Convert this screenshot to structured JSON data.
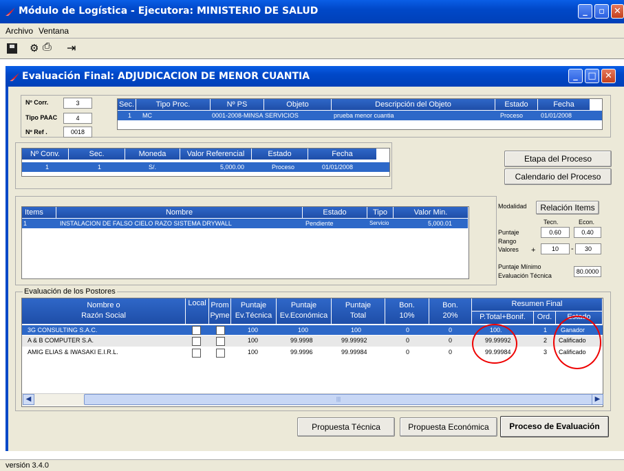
{
  "main_window": {
    "title": "Módulo de Logística - Ejecutora: MINISTERIO DE SALUD"
  },
  "menu": {
    "items": [
      "Archivo",
      "Ventana"
    ]
  },
  "child_window": {
    "title": "Evaluación Final: ADJUDICACION DE MENOR CUANTIA"
  },
  "info": {
    "corr_label": "Nº Corr.",
    "corr_value": "3",
    "paac_label": "Tipo PAAC",
    "paac_value": "4",
    "ref_label": "Nº Ref .",
    "ref_value": "0018"
  },
  "proc_table": {
    "headers": [
      "Sec.",
      "Tipo Proc.",
      "Nº PS",
      "Objeto",
      "Descripción del Objeto",
      "Estado",
      "Fecha"
    ],
    "row": [
      "1",
      "MC",
      "0001-2008-MINSA",
      "SERVICIOS",
      "prueba menor cuantia",
      "Proceso",
      "01/01/2008"
    ]
  },
  "conv_table": {
    "headers": [
      "Nº Conv.",
      "Sec.",
      "Moneda",
      "Valor Referencial",
      "Estado",
      "Fecha"
    ],
    "row": [
      "1",
      "1",
      "S/.",
      "5,000.00",
      "Proceso",
      "01/01/2008"
    ]
  },
  "side_buttons": {
    "etapa": "Etapa del Proceso",
    "calendario": "Calendario del Proceso"
  },
  "items_table": {
    "headers": [
      "Items",
      "Nombre",
      "Estado",
      "Tipo",
      "Valor Min."
    ],
    "row": [
      "1",
      "INSTALACION DE FALSO CIELO RAZO SISTEMA DRYWALL",
      "Pendiente",
      "Servicio",
      "5,000.01"
    ]
  },
  "modalidad": {
    "label": "Modalidad",
    "button": "Relación Items",
    "tecn_label": "Tecn.",
    "econ_label": "Econ.",
    "puntaje_label": "Puntaje",
    "tecn_value": "0.60",
    "econ_value": "0.40",
    "rango_label1": "Rango",
    "rango_label2": "Valores",
    "plus": "+",
    "rango_min": "10",
    "dash": "-",
    "rango_max": "30",
    "minimo_label1": "Puntaje Mínimo",
    "minimo_label2": "Evaluación Técnica",
    "minimo_value": "80.0000"
  },
  "postores": {
    "group_label": "Evaluación de los Postores",
    "headers": {
      "nombre1": "Nombre o",
      "nombre2": "Razón Social",
      "local": "Local",
      "prom1": "Prom",
      "prom2": "Pyme",
      "ptec1": "Puntaje",
      "ptec2": "Ev.Técnica",
      "peco1": "Puntaje",
      "peco2": "Ev.Económica",
      "ptot1": "Puntaje",
      "ptot2": "Total",
      "b10a": "Bon.",
      "b10b": "10%",
      "b20a": "Bon.",
      "b20b": "20%",
      "resumen": "Resumen Final",
      "ptotb": "P.Total+Bonif.",
      "ord": "Ord.",
      "estado": "Estado"
    },
    "rows": [
      {
        "nombre": "3G CONSULTING S.A.C.",
        "ptec": "100",
        "peco": "100",
        "ptot": "100",
        "b10": "0",
        "b20": "0",
        "ptotb": "100.",
        "ord": "1",
        "estado": "Ganador"
      },
      {
        "nombre": "A & B COMPUTER S.A.",
        "ptec": "100",
        "peco": "99.9998",
        "ptot": "99.99992",
        "b10": "0",
        "b20": "0",
        "ptotb": "99.99992",
        "ord": "2",
        "estado": "Calificado"
      },
      {
        "nombre": "AMIG ELIAS & IWASAKI E.I.R.L.",
        "ptec": "100",
        "peco": "99.9996",
        "ptot": "99.99984",
        "b10": "0",
        "b20": "0",
        "ptotb": "99.99984",
        "ord": "3",
        "estado": "Calificado"
      }
    ],
    "scroll_mid": "|||"
  },
  "bottom_buttons": {
    "tecnica": "Propuesta Técnica",
    "economica": "Propuesta Económica",
    "evaluacion": "Proceso de Evaluación"
  },
  "status": {
    "version": "versión 3.4.0"
  },
  "colors": {
    "titlebar": "#0048c8",
    "header": "#2f67c8",
    "selected": "#2d68c8",
    "highlight_circle": "#e00000"
  }
}
